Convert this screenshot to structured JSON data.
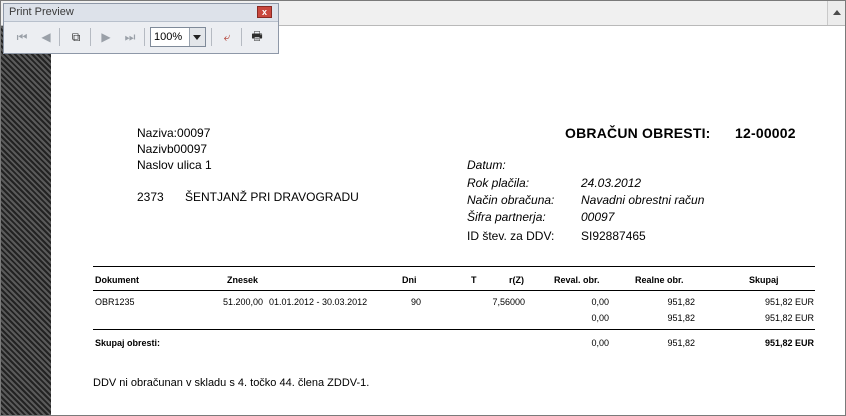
{
  "toolbar": {
    "title": "Print Preview",
    "close_glyph": "x",
    "zoom_value": "100%",
    "buttons": {
      "first": "⏮",
      "prev": "◀",
      "pages": "⧉",
      "next": "▶",
      "last": "⏭",
      "exit": "⤶",
      "print": "🖶"
    }
  },
  "document": {
    "address": {
      "line1": "Naziva:00097",
      "line2": "Nazivb00097",
      "line3": "Naslov ulica 1",
      "postal_code": "2373",
      "city": "ŠENTJANŽ PRI DRAVOGRADU"
    },
    "title_label": "OBRAČUN OBRESTI:",
    "title_number": "12-00002",
    "meta": [
      {
        "label": "Datum:",
        "value": ""
      },
      {
        "label": "Rok plačila:",
        "value": "24.03.2012"
      },
      {
        "label": "Način obračuna:",
        "value": "Navadni obrestni račun"
      },
      {
        "label": "Šifra partnerja:",
        "value": "00097"
      },
      {
        "label": "ID štev. za DDV:",
        "value": "SI92887465"
      }
    ],
    "table": {
      "headers": {
        "dokument": "Dokument",
        "znesek": "Znesek",
        "dni": "Dni",
        "t": "T",
        "rz": "r(Z)",
        "reval": "Reval. obr.",
        "realne": "Realne obr.",
        "skupaj": "Skupaj"
      },
      "rows": [
        {
          "dokument": "OBR1235",
          "znesek": "51.200,00",
          "period": "01.01.2012 - 30.03.2012",
          "dni": "90",
          "rz": "7,56000",
          "reval": "0,00",
          "realne": "951,82",
          "skupaj": "951,82  EUR"
        },
        {
          "dokument": "",
          "znesek": "",
          "period": "",
          "dni": "",
          "rz": "",
          "reval": "0,00",
          "realne": "951,82",
          "skupaj": "951,82  EUR"
        }
      ],
      "total": {
        "label": "Skupaj obresti:",
        "reval": "0,00",
        "realne": "951,82",
        "skupaj": "951,82  EUR"
      }
    },
    "note": "DDV ni obračunan v skladu s 4. točko 44. člena ZDDV-1."
  }
}
